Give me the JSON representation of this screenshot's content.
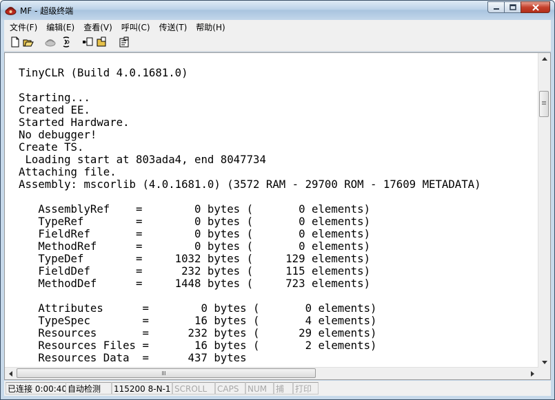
{
  "window": {
    "title": "MF - 超级终端"
  },
  "menu": [
    "文件(F)",
    "编辑(E)",
    "查看(V)",
    "呼叫(C)",
    "传送(T)",
    "帮助(H)"
  ],
  "toolbar": {
    "icons": [
      "new-document-icon",
      "open-folder-icon",
      "disconnect-phone-icon",
      "connect-phone-icon",
      "send-file-icon",
      "receive-file-icon",
      "properties-icon"
    ]
  },
  "console": {
    "lines": [
      "TinyCLR (Build 4.0.1681.0)",
      "",
      "Starting...",
      "Created EE.",
      "Started Hardware.",
      "No debugger!",
      "Create TS.",
      " Loading start at 803ada4, end 8047734",
      "Attaching file.",
      "Assembly: mscorlib (4.0.1681.0) (3572 RAM - 29700 ROM - 17609 METADATA)",
      "",
      "   AssemblyRef    =        0 bytes (       0 elements)",
      "   TypeRef        =        0 bytes (       0 elements)",
      "   FieldRef       =        0 bytes (       0 elements)",
      "   MethodRef      =        0 bytes (       0 elements)",
      "   TypeDef        =     1032 bytes (     129 elements)",
      "   FieldDef       =      232 bytes (     115 elements)",
      "   MethodDef      =     1448 bytes (     723 elements)",
      "",
      "   Attributes      =        0 bytes (       0 elements)",
      "   TypeSpec        =       16 bytes (       4 elements)",
      "   Resources       =      232 bytes (      29 elements)",
      "   Resources Files =       16 bytes (       2 elements)",
      "   Resources Data  =      437 bytes"
    ]
  },
  "scrollbars": {
    "h_grip": "III"
  },
  "status": {
    "connected": "已连接 0:00:40",
    "detect": "自动检测",
    "port": "115200 8-N-1",
    "scroll": "SCROLL",
    "caps": "CAPS",
    "num": "NUM",
    "capture": "捕",
    "print": "打印"
  }
}
